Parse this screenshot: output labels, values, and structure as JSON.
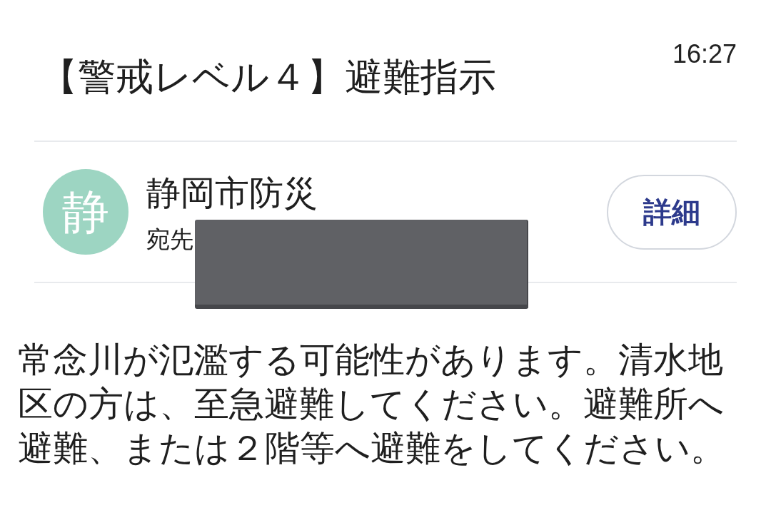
{
  "message": {
    "title": "【警戒レベル４】避難指示",
    "time": "16:27"
  },
  "sender": {
    "avatar_letter": "静",
    "name": "静岡市防災",
    "recipient_label": "宛先",
    "recipient_redacted": true
  },
  "details_button": {
    "label": "詳細"
  },
  "body": "常念川が氾濫する可能性があります。清水地区の方は、至急避難してください。避難所へ避難、または２階等へ避難をしてください。"
}
